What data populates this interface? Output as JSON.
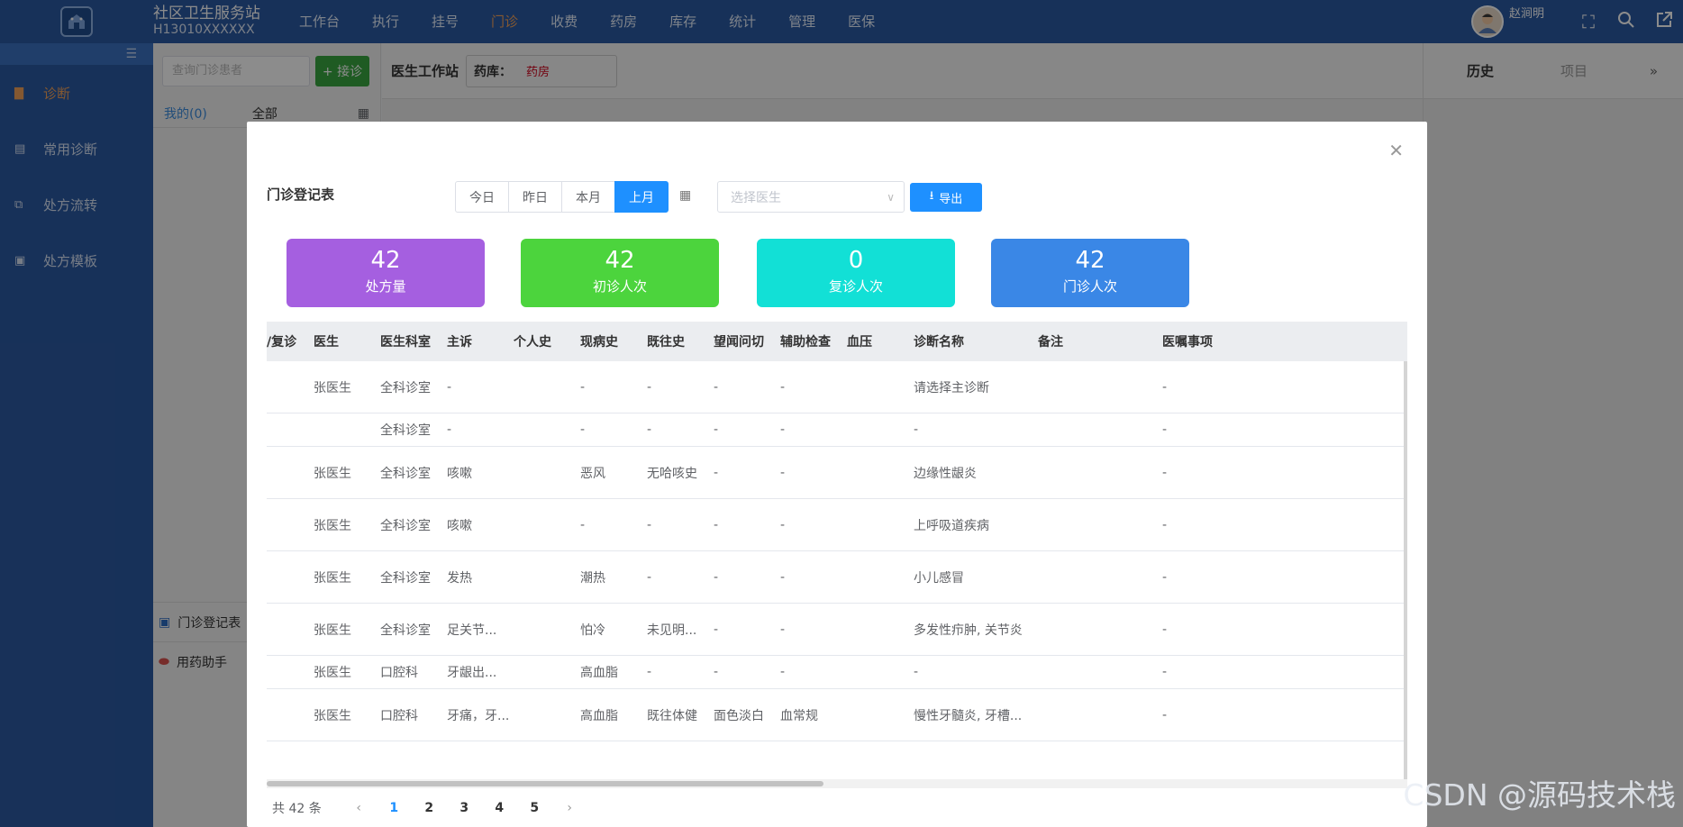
{
  "header": {
    "site_name": "社区卫生服务站",
    "site_code": "H13010XXXXXX",
    "nav": [
      "工作台",
      "执行",
      "挂号",
      "门诊",
      "收费",
      "药房",
      "库存",
      "统计",
      "管理",
      "医保"
    ],
    "active_nav": "门诊",
    "user_name": "赵涧明"
  },
  "sidebar": {
    "items": [
      {
        "label": "诊断",
        "icon": "document-icon"
      },
      {
        "label": "常用诊断",
        "icon": "list-icon"
      },
      {
        "label": "处方流转",
        "icon": "share-icon"
      },
      {
        "label": "处方模板",
        "icon": "template-icon"
      }
    ],
    "active": "诊断"
  },
  "patient_panel": {
    "search_placeholder": "查询门诊患者",
    "accept_label": "+ 接诊",
    "tab_mine": "我的(0)",
    "tab_all": "全部",
    "links": [
      {
        "label": "门诊登记表",
        "icon": "chart-icon"
      },
      {
        "label": "用药助手",
        "icon": "pill-icon"
      }
    ]
  },
  "workstation": {
    "title": "医生工作站",
    "pharmacy_label": "药库：",
    "pharmacy_value": "药房"
  },
  "history": {
    "tab_history": "历史",
    "tab_items": "项目",
    "expand": "»"
  },
  "modal": {
    "title": "门诊登记表",
    "ranges": [
      "今日",
      "昨日",
      "本月",
      "上月"
    ],
    "active_range": "上月",
    "doctor_placeholder": "选择医生",
    "export_label": "导出",
    "stats": [
      {
        "value": "42",
        "label": "处方量",
        "color": "#a55fe0"
      },
      {
        "value": "42",
        "label": "初诊人次",
        "color": "#4cd43d"
      },
      {
        "value": "0",
        "label": "复诊人次",
        "color": "#12e0d6"
      },
      {
        "value": "42",
        "label": "门诊人次",
        "color": "#3a87e6"
      }
    ],
    "columns": [
      "/复诊",
      "医生",
      "医生科室",
      "主诉",
      "个人史",
      "现病史",
      "既往史",
      "望闻问切",
      "辅助检查",
      "血压",
      "诊断名称",
      "备注",
      "医嘱事项"
    ],
    "rows": [
      [
        "",
        "张医生",
        "全科诊室",
        "-",
        "",
        "-",
        "-",
        "-",
        "-",
        "",
        "请选择主诊断",
        "",
        "-"
      ],
      [
        "",
        "",
        "全科诊室",
        "-",
        "",
        "-",
        "-",
        "-",
        "-",
        "",
        "-",
        "",
        "-"
      ],
      [
        "",
        "张医生",
        "全科诊室",
        "咳嗽",
        "",
        "恶风",
        "无哈咳史",
        "-",
        "-",
        "",
        "边缘性龈炎",
        "",
        "-"
      ],
      [
        "",
        "张医生",
        "全科诊室",
        "咳嗽",
        "",
        "-",
        "-",
        "-",
        "-",
        "",
        "上呼吸道疾病",
        "",
        "-"
      ],
      [
        "",
        "张医生",
        "全科诊室",
        "发热",
        "",
        "潮热",
        "-",
        "-",
        "-",
        "",
        "小儿感冒",
        "",
        "-"
      ],
      [
        "",
        "张医生",
        "全科诊室",
        "足关节...",
        "",
        "怕冷",
        "未见明...",
        "-",
        "-",
        "",
        "多发性疖肿, 关节炎",
        "",
        "-"
      ],
      [
        "",
        "张医生",
        "口腔科",
        "牙龈出...",
        "",
        "高血脂",
        "-",
        "-",
        "-",
        "",
        "-",
        "",
        "-"
      ],
      [
        "",
        "张医生",
        "口腔科",
        "牙痛，牙...",
        "",
        "高血脂",
        "既往体健",
        "面色淡白",
        "血常规",
        "",
        "慢性牙髓炎, 牙槽...",
        "",
        "-"
      ]
    ],
    "pager": {
      "total": "共 42 条",
      "pages": [
        "1",
        "2",
        "3",
        "4",
        "5"
      ],
      "active_page": "1"
    }
  },
  "watermark": "CSDN @源码技术栈"
}
